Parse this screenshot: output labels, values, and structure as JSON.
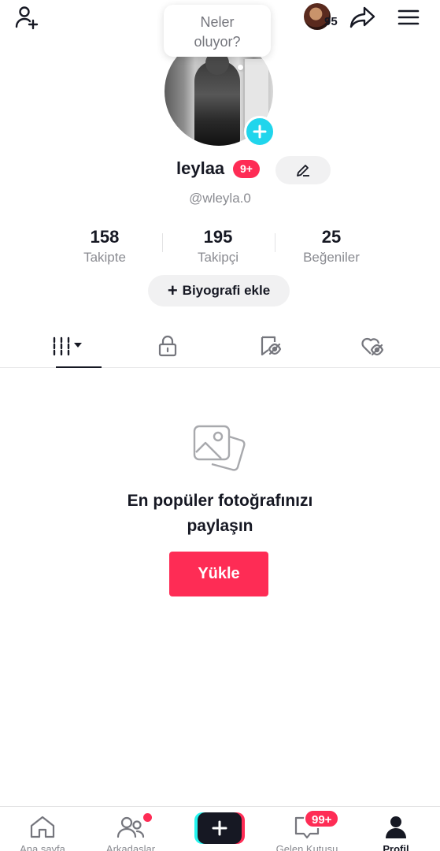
{
  "header": {
    "add_friend_icon": "person-plus-icon",
    "story_count": "95",
    "share_icon": "share-arrow-icon",
    "menu_icon": "hamburger-menu-icon"
  },
  "status_bubble": {
    "line1": "Neler",
    "line2": "oluyor?"
  },
  "profile": {
    "username": "leylaa",
    "badge": "9+",
    "handle": "@wleyla.0",
    "edit_icon": "pencil-icon"
  },
  "stats": [
    {
      "value": "158",
      "label": "Takipte"
    },
    {
      "value": "195",
      "label": "Takipçi"
    },
    {
      "value": "25",
      "label": "Beğeniler"
    }
  ],
  "bio_button": {
    "plus": "+",
    "label": "Biyografi ekle"
  },
  "tabs": [
    {
      "icon": "grid-dropdown-icon",
      "active": true
    },
    {
      "icon": "lock-icon",
      "active": false
    },
    {
      "icon": "bookmark-hidden-icon",
      "active": false
    },
    {
      "icon": "heart-hidden-icon",
      "active": false
    }
  ],
  "empty_state": {
    "icon": "photos-icon",
    "title_line1": "En popüler fotoğrafınızı",
    "title_line2": "paylaşın",
    "button": "Yükle"
  },
  "bottom_nav": {
    "home": "Ana sayfa",
    "friends": "Arkadaşlar",
    "inbox": "Gelen Kutusu",
    "inbox_badge": "99+",
    "profile": "Profil"
  },
  "colors": {
    "accent": "#fe2c55",
    "cyan": "#20d5ec",
    "text": "#161823",
    "secondary": "#8a8b91"
  }
}
